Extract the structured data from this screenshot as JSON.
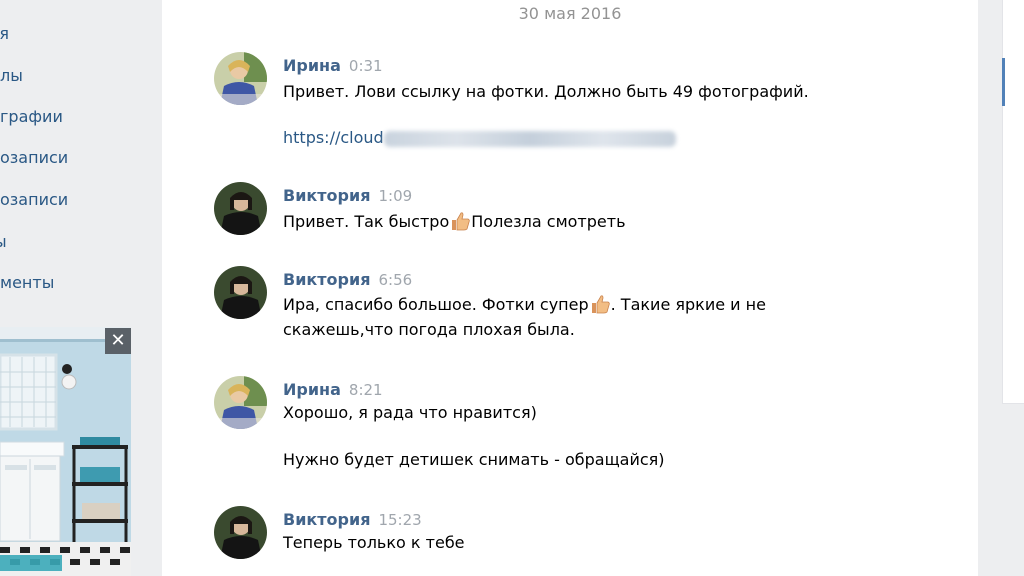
{
  "sidebar": {
    "items": [
      {
        "label": "ья"
      },
      {
        "label": "лы"
      },
      {
        "label": "графии"
      },
      {
        "label": "озаписи"
      },
      {
        "label": "озаписи"
      },
      {
        "label": "ы"
      },
      {
        "label": "менты"
      }
    ],
    "ad_close": "✕"
  },
  "chat": {
    "date": "30 мая 2016",
    "messages": [
      {
        "author": "Ирина",
        "time": "0:31",
        "line1": "Привет. Лови ссылку на фотки. Должно быть 49 фотографий.",
        "link": "https://cloud"
      },
      {
        "author": "Виктория",
        "time": "1:09",
        "text_before": "Привет. Так быстро",
        "text_after": "Полезла смотреть"
      },
      {
        "author": "Виктория",
        "time": "6:56",
        "text_before": "Ира, спасибо большое. Фотки супер",
        "text_after": ". Такие яркие и не",
        "line2": "скажешь,что погода плохая была."
      },
      {
        "author": "Ирина",
        "time": "8:21",
        "line1": "Хорошо, я рада что нравится)",
        "line2": "Нужно будет детишек снимать - обращайся)"
      },
      {
        "author": "Виктория",
        "time": "15:23",
        "line1": "Теперь только к тебе"
      }
    ]
  },
  "colors": {
    "author": "#42648b",
    "time": "#a0a6ad",
    "link": "#2a5885",
    "date": "#939393",
    "accent": "#5181b8"
  },
  "icons": {
    "emoji": "thumbs-up-icon",
    "close": "close-icon"
  }
}
